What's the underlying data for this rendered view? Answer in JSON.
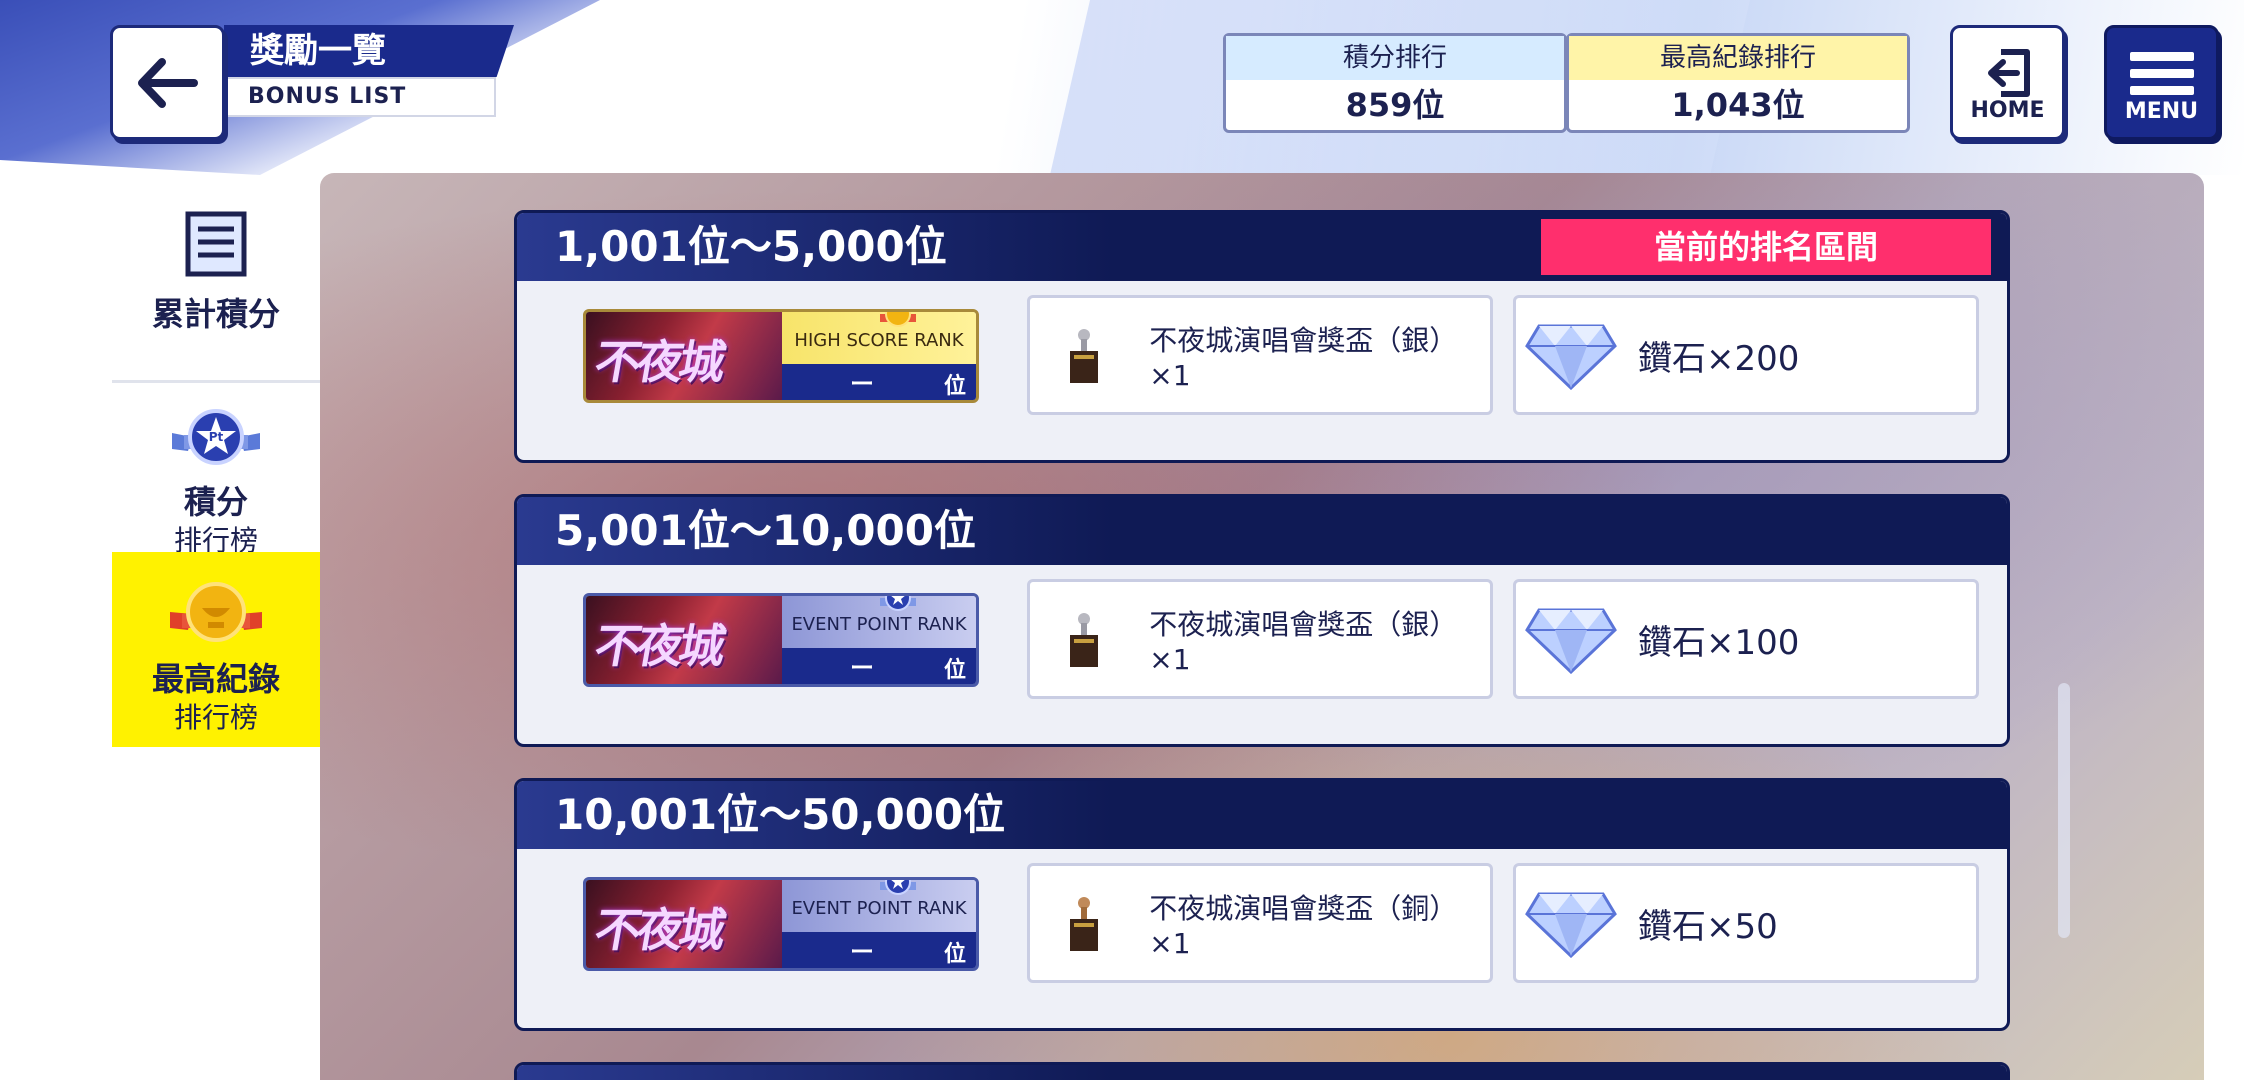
{
  "header": {
    "title": "獎勵一覽",
    "subtitle": "BONUS LIST",
    "points_rank_label": "積分排行",
    "points_rank_value": "859位",
    "best_rank_label": "最高紀錄排行",
    "best_rank_value": "1,043位",
    "home_label": "HOME",
    "menu_label": "MENU"
  },
  "sidebar": {
    "items": [
      {
        "label": "累計積分",
        "sub": "",
        "selected": false,
        "icon": "list-icon"
      },
      {
        "label": "積分",
        "sub": "排行榜",
        "selected": false,
        "icon": "pt-star-badge-icon"
      },
      {
        "label": "最高紀錄",
        "sub": "排行榜",
        "selected": true,
        "icon": "gold-medal-icon"
      }
    ]
  },
  "tiers": [
    {
      "range": "1,001位～5,000位",
      "current_tag": "當前的排名區間",
      "badge_logo": "不夜城",
      "badge_type": "HIGH SCORE RANK",
      "badge_dash": "ー",
      "badge_pos": "位",
      "badge_style": "gold",
      "reward1": "不夜城演唱會獎盃（銀）×1",
      "reward2": "鑽石×200"
    },
    {
      "range": "5,001位～10,000位",
      "current_tag": "",
      "badge_logo": "不夜城",
      "badge_type": "EVENT POINT RANK",
      "badge_dash": "ー",
      "badge_pos": "位",
      "badge_style": "blue",
      "reward1": "不夜城演唱會獎盃（銀）×1",
      "reward2": "鑽石×100"
    },
    {
      "range": "10,001位～50,000位",
      "current_tag": "",
      "badge_logo": "不夜城",
      "badge_type": "EVENT POINT RANK",
      "badge_dash": "ー",
      "badge_pos": "位",
      "badge_style": "blue",
      "reward1": "不夜城演唱會獎盃（銅）×1",
      "reward2": "鑽石×50"
    }
  ],
  "colors": {
    "navy": "#1a2a8c",
    "current_tag": "#ff2f6d",
    "selected_sidebar": "#fff200",
    "points_label_bg": "#d6ebff",
    "best_label_bg": "#fff4a8"
  }
}
